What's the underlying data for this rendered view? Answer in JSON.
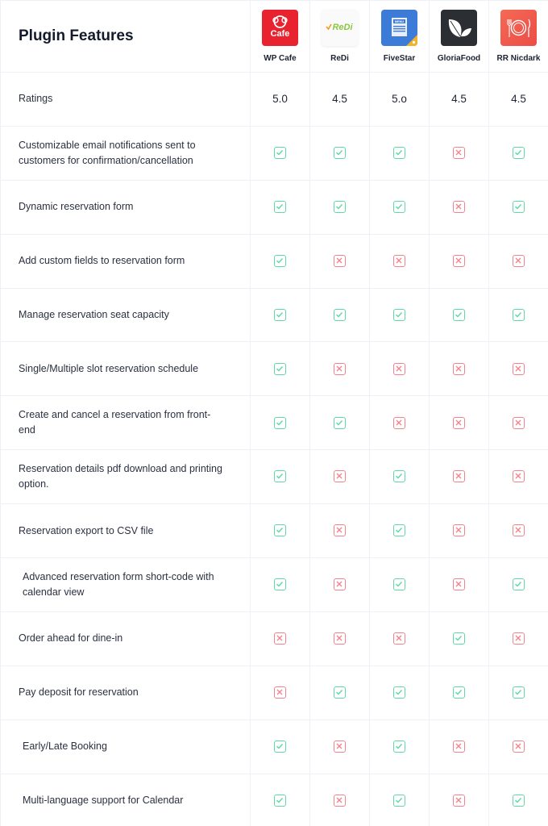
{
  "title": "Plugin Features",
  "colors": {
    "check": "#5fd9a6",
    "cross": "#f2838d",
    "border": "#eef0f8"
  },
  "plugins": [
    {
      "name": "WP Cafe",
      "icon": "wp-cafe-logo",
      "logo_text": "Cafe"
    },
    {
      "name": "ReDi",
      "icon": "redi-logo",
      "logo_text": "ReDi"
    },
    {
      "name": "FiveStar",
      "icon": "fivestar-menu-logo",
      "logo_text": "MENU"
    },
    {
      "name": "GloriaFood",
      "icon": "gloriafood-leaf-logo",
      "logo_text": ""
    },
    {
      "name": "RR Nicdark",
      "icon": "rr-nicdark-plate-logo",
      "logo_text": ""
    }
  ],
  "ratings": {
    "label": "Ratings",
    "values": [
      "5.0",
      "4.5",
      "5.o",
      "4.5",
      "4.5"
    ]
  },
  "features": [
    {
      "label": "Customizable email notifications sent to customers for confirmation/cancellation",
      "indent": false,
      "support": [
        true,
        true,
        true,
        false,
        true
      ]
    },
    {
      "label": "Dynamic reservation form",
      "indent": false,
      "support": [
        true,
        true,
        true,
        false,
        true
      ]
    },
    {
      "label": "Add custom fields to reservation form",
      "indent": false,
      "support": [
        true,
        false,
        false,
        false,
        false
      ]
    },
    {
      "label": "Manage reservation seat capacity",
      "indent": false,
      "support": [
        true,
        true,
        true,
        true,
        true
      ]
    },
    {
      "label": "Single/Multiple slot reservation schedule",
      "indent": false,
      "support": [
        true,
        false,
        false,
        false,
        false
      ]
    },
    {
      "label": "Create and cancel a reservation from front-end",
      "indent": false,
      "support": [
        true,
        true,
        false,
        false,
        false
      ]
    },
    {
      "label": "Reservation details pdf download and printing option.",
      "indent": false,
      "support": [
        true,
        false,
        true,
        false,
        false
      ]
    },
    {
      "label": "Reservation export to CSV file",
      "indent": false,
      "support": [
        true,
        false,
        true,
        false,
        false
      ]
    },
    {
      "label": "Advanced reservation form short-code with calendar view",
      "indent": true,
      "support": [
        true,
        false,
        true,
        false,
        true
      ]
    },
    {
      "label": "Order ahead for dine-in",
      "indent": false,
      "support": [
        false,
        false,
        false,
        true,
        false
      ]
    },
    {
      "label": "Pay deposit for reservation",
      "indent": false,
      "support": [
        false,
        true,
        true,
        true,
        true
      ]
    },
    {
      "label": "Early/Late Booking",
      "indent": true,
      "support": [
        true,
        false,
        true,
        false,
        false
      ]
    },
    {
      "label": "Multi-language support for Calendar",
      "indent": true,
      "support": [
        true,
        false,
        true,
        false,
        true
      ]
    }
  ]
}
